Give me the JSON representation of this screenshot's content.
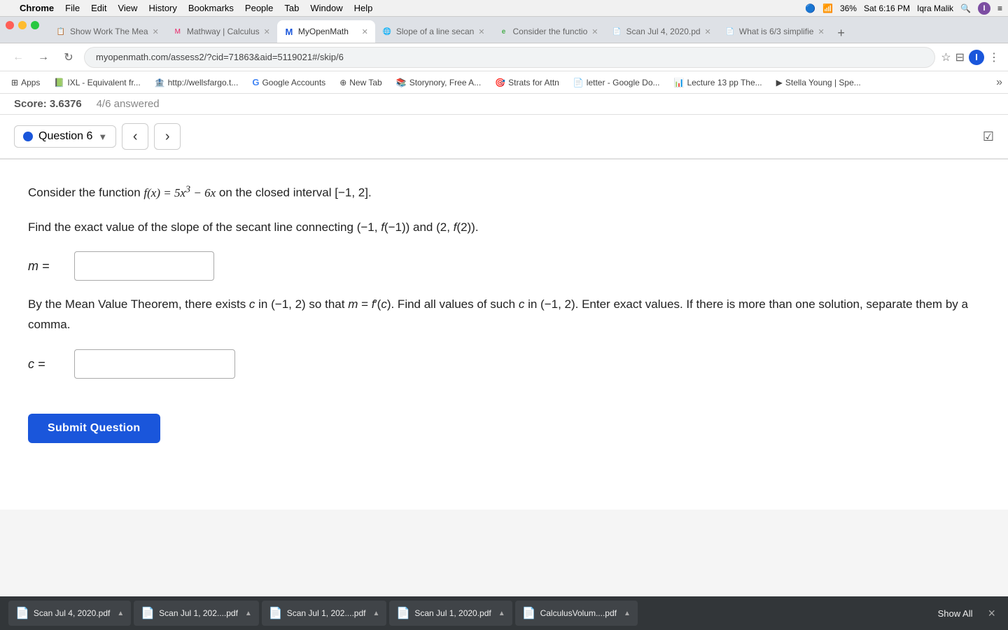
{
  "menubar": {
    "apple": "⌘",
    "items": [
      "Chrome",
      "File",
      "Edit",
      "View",
      "History",
      "Bookmarks",
      "People",
      "Tab",
      "Window",
      "Help"
    ],
    "right": {
      "battery": "36%",
      "time": "Sat 6:16 PM",
      "user": "Iqra Malik"
    }
  },
  "tabs": [
    {
      "id": "tab1",
      "favicon": "📋",
      "title": "Show Work The Mea",
      "active": false
    },
    {
      "id": "tab2",
      "favicon": "📐",
      "title": "Mathway | Calculus",
      "active": false
    },
    {
      "id": "tab3",
      "favicon": "M",
      "title": "MyOpenMath",
      "active": true
    },
    {
      "id": "tab4",
      "favicon": "🌐",
      "title": "Slope of a line secan",
      "active": false
    },
    {
      "id": "tab5",
      "favicon": "e",
      "title": "Consider the functio",
      "active": false
    },
    {
      "id": "tab6",
      "favicon": "📄",
      "title": "Scan Jul 4, 2020.pd",
      "active": false
    },
    {
      "id": "tab7",
      "favicon": "📄",
      "title": "What is 6/3 simplifie",
      "active": false
    }
  ],
  "address_bar": {
    "url": "myopenmath.com/assess2/?cid=71863&aid=5119021#/skip/6"
  },
  "bookmarks": [
    {
      "icon": "🔷",
      "label": "Apps"
    },
    {
      "icon": "📚",
      "label": "IXL - Equivalent fr..."
    },
    {
      "icon": "🏦",
      "label": "http://wellsfargo.t..."
    },
    {
      "icon": "G",
      "label": "Google Accounts"
    },
    {
      "icon": "🌐",
      "label": "New Tab"
    },
    {
      "icon": "📖",
      "label": "Storynory, Free A..."
    },
    {
      "icon": "🎯",
      "label": "Strats for Attn"
    },
    {
      "icon": "📄",
      "label": "letter - Google Do..."
    },
    {
      "icon": "📊",
      "label": "Lecture 13 pp The..."
    },
    {
      "icon": "▶",
      "label": "Stella Young | Spe..."
    }
  ],
  "score": {
    "label": "Score: 3.6376",
    "answered": "4/6 answered"
  },
  "question_nav": {
    "question_label": "Question 6",
    "dropdown_arrow": "▼",
    "prev_arrow": "‹",
    "next_arrow": "›"
  },
  "question": {
    "problem_text_1": "Consider the function",
    "function": "f(x) = 5x³ − 6x",
    "interval": "on the closed interval [−1, 2].",
    "problem_text_2": "Find the exact value of the slope of the secant line connecting (−1, f(−1)) and (2, f(2)).",
    "m_label": "m =",
    "m_placeholder": "",
    "mvt_text": "By the Mean Value Theorem, there exists c in (−1, 2) so that m = f′(c). Find all values of such c in (−1, 2). Enter exact values. If there is more than one solution, separate them by a comma.",
    "c_label": "c =",
    "c_placeholder": "",
    "submit_label": "Submit Question"
  },
  "downloads": [
    {
      "icon": "📄",
      "name": "Scan Jul 4, 2020.pdf"
    },
    {
      "icon": "📄",
      "name": "Scan Jul 1, 202....pdf"
    },
    {
      "icon": "📄",
      "name": "Scan Jul 1, 202....pdf"
    },
    {
      "icon": "📄",
      "name": "Scan Jul 1, 2020.pdf"
    },
    {
      "icon": "📄",
      "name": "CalculusVolum....pdf"
    }
  ],
  "downloads_show_all": "Show All",
  "downloads_close": "×"
}
